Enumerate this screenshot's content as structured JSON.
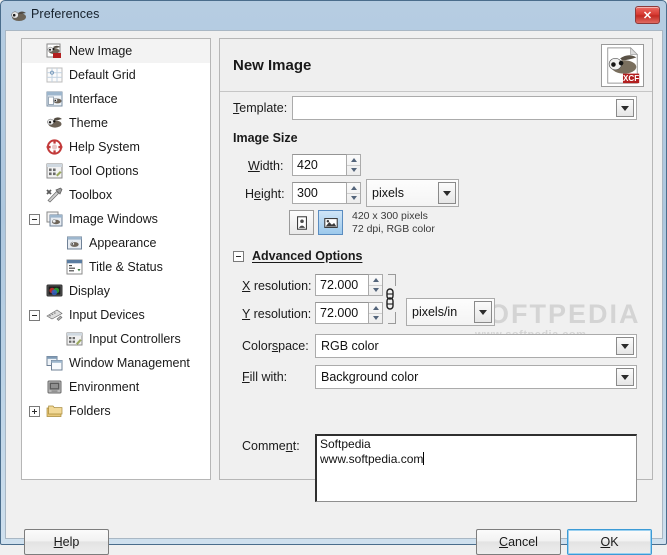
{
  "window": {
    "title": "Preferences",
    "title_icon": "wilber-icon",
    "close_label": "✕"
  },
  "sidebar": {
    "items": [
      {
        "label": "New Image",
        "icon": "new-image-icon",
        "indent": 0,
        "expander": "none",
        "selected": true
      },
      {
        "label": "Default Grid",
        "icon": "default-grid-icon",
        "indent": 0,
        "expander": "none",
        "selected": false
      },
      {
        "label": "Interface",
        "icon": "interface-icon",
        "indent": 0,
        "expander": "none",
        "selected": false
      },
      {
        "label": "Theme",
        "icon": "theme-icon",
        "indent": 0,
        "expander": "none",
        "selected": false
      },
      {
        "label": "Help System",
        "icon": "help-system-icon",
        "indent": 0,
        "expander": "none",
        "selected": false
      },
      {
        "label": "Tool Options",
        "icon": "tool-options-icon",
        "indent": 0,
        "expander": "none",
        "selected": false
      },
      {
        "label": "Toolbox",
        "icon": "toolbox-icon",
        "indent": 0,
        "expander": "none",
        "selected": false
      },
      {
        "label": "Image Windows",
        "icon": "image-windows-icon",
        "indent": 0,
        "expander": "minus",
        "selected": false
      },
      {
        "label": "Appearance",
        "icon": "appearance-icon",
        "indent": 1,
        "expander": "none",
        "selected": false
      },
      {
        "label": "Title & Status",
        "icon": "title-status-icon",
        "indent": 1,
        "expander": "none",
        "selected": false
      },
      {
        "label": "Display",
        "icon": "display-icon",
        "indent": 0,
        "expander": "none",
        "selected": false
      },
      {
        "label": "Input Devices",
        "icon": "input-devices-icon",
        "indent": 0,
        "expander": "minus",
        "selected": false
      },
      {
        "label": "Input Controllers",
        "icon": "input-controllers-icon",
        "indent": 1,
        "expander": "none",
        "selected": false
      },
      {
        "label": "Window Management",
        "icon": "window-management-icon",
        "indent": 0,
        "expander": "none",
        "selected": false
      },
      {
        "label": "Environment",
        "icon": "environment-icon",
        "indent": 0,
        "expander": "none",
        "selected": false
      },
      {
        "label": "Folders",
        "icon": "folders-icon",
        "indent": 0,
        "expander": "plus",
        "selected": false
      }
    ]
  },
  "panel": {
    "title": "New Image",
    "page_icon": "xcf-file-icon",
    "xcf_badge": "XCF",
    "template": {
      "label": "Template:",
      "label_mnemonic": "T",
      "value": "",
      "placeholder": ""
    },
    "image_size": {
      "section_label": "Image Size",
      "width_label": "Width:",
      "width_mnemonic": "W",
      "width_value": "420",
      "height_label": "Height:",
      "height_mnemonic": "e",
      "height_value": "300",
      "unit_value": "pixels",
      "orientation": {
        "portrait_icon": "portrait-orientation-icon",
        "landscape_icon": "landscape-orientation-icon",
        "selected": "landscape"
      },
      "info_line1": "420 x 300 pixels",
      "info_line2": "72 dpi, RGB color"
    },
    "advanced": {
      "section_label": "Advanced Options",
      "section_mnemonic": "A",
      "expanded": true,
      "x_res_label": "X resolution:",
      "x_res_mnemonic": "X",
      "x_res_value": "72.000",
      "y_res_label": "Y resolution:",
      "y_res_mnemonic": "Y",
      "y_res_value": "72.000",
      "res_unit_value": "pixels/in",
      "chain_icon": "chain-linked-icon",
      "colorspace_label": "Colorspace:",
      "colorspace_mnemonic": "s",
      "colorspace_value": "RGB color",
      "fill_label": "Fill with:",
      "fill_mnemonic": "F",
      "fill_value": "Background color",
      "comment_label": "Comment:",
      "comment_mnemonic": "n",
      "comment_line1": "Softpedia",
      "comment_line2": "www.softpedia.com"
    }
  },
  "buttons": {
    "help": "Help",
    "help_mnemonic": "H",
    "cancel": "Cancel",
    "cancel_mnemonic": "C",
    "ok": "OK",
    "ok_mnemonic": "O"
  },
  "watermark": {
    "line1": "SOFTPEDIA",
    "line2": "www.softpedia.com"
  },
  "colors": {
    "titlebar": "#b6cde2",
    "dialog_bg": "#f0f0f0",
    "accent_blue": "#3c9bd6",
    "close_red": "#d83c34",
    "selection": "#f3f3f3"
  }
}
